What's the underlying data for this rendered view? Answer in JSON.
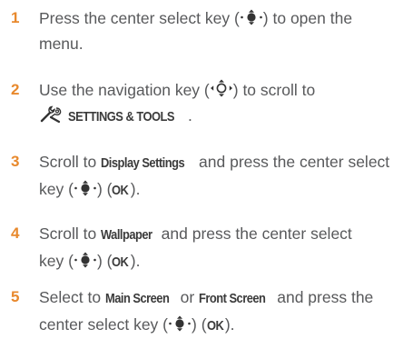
{
  "steps": [
    {
      "num": "1",
      "parts": [
        "Press the center select key (",
        ") to open the",
        "menu."
      ]
    },
    {
      "num": "2",
      "parts": [
        "Use the navigation key (",
        ") to scroll to",
        "SETTINGS & TOOLS",
        "."
      ]
    },
    {
      "num": "3",
      "parts": [
        "Scroll to ",
        "Display Settings",
        " and press the center select",
        "key (",
        ") (",
        "OK",
        ")."
      ]
    },
    {
      "num": "4",
      "parts": [
        "Scroll to ",
        "Wallpaper",
        " and press the center select",
        "key (",
        ") (",
        "OK",
        ")."
      ]
    },
    {
      "num": "5",
      "parts": [
        "Select to ",
        "Main Screen",
        " or ",
        "Front Screen",
        " and press the",
        "center select key (",
        ") (",
        "OK",
        ")."
      ]
    }
  ],
  "icons": {
    "center_select": "center-select-key-icon",
    "navigation": "navigation-key-icon",
    "settings_tools": "settings-tools-icon"
  },
  "colors": {
    "step_number": "#e8892d",
    "body_text": "#58595b",
    "emphasis_text": "#3b3b3b"
  }
}
